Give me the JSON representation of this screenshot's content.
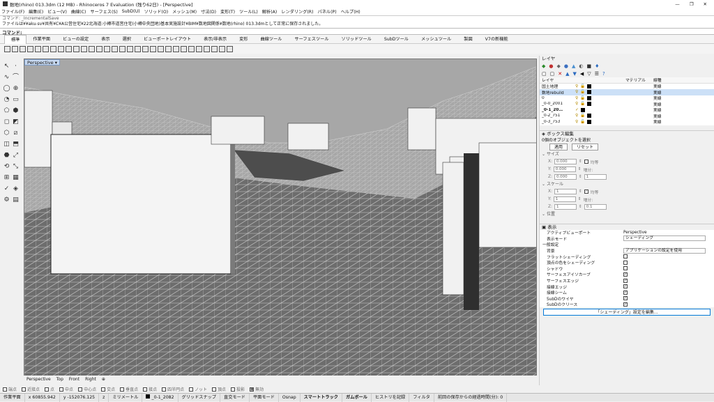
{
  "window": {
    "title": "数地(rhino) 013.3dm (12 MB) - Rhinoceros 7 Evaluation (残り62日) - [Perspective]"
  },
  "menu": [
    "ファイル(F)",
    "編集(E)",
    "ビュー(V)",
    "曲線(C)",
    "サーフェス(S)",
    "SubD(U)",
    "ソリッド(O)",
    "メッシュ(M)",
    "寸法(D)",
    "変形(T)",
    "ツール(L)",
    "解析(A)",
    "レンダリング(R)",
    "パネル(P)",
    "ヘルプ(H)"
  ],
  "cmd": {
    "line1": "コマンド: _IncrementalSave",
    "line2": "ファイルは¥¥aku-sv¥共有¥C¥A公営住宅¥22北海道:小樽市道営住宅(小樽中央団地)基本実施設計¥BIM¥数地図関係¥数地(rhino) 013.3dmとして正常に保存されました。",
    "prompt": "コマンド:"
  },
  "tabs": [
    "標準",
    "作業平面",
    "ビューの設定",
    "表示",
    "選択",
    "ビューポートレイアウト",
    "表示/非表示",
    "変形",
    "曲線ツール",
    "サーフェスツール",
    "ソリッドツール",
    "SubDツール",
    "メッシュツール",
    "製図",
    "V7の新機能"
  ],
  "viewport": {
    "name": "Perspective",
    "tabs": [
      "Perspective",
      "Top",
      "Front",
      "Right"
    ]
  },
  "layers": {
    "title": "レイヤ",
    "headers": {
      "name": "レイヤ",
      "material": "マテリアル",
      "linetype": "線種"
    },
    "rows": [
      {
        "name": "国土地理",
        "line": "実線",
        "sel": false
      },
      {
        "name": "数地rebuild",
        "line": "実線",
        "sel": true
      },
      {
        "name": "0",
        "line": "実線",
        "sel": false
      },
      {
        "name": "_0-0_2001",
        "line": "実線",
        "sel": false
      },
      {
        "name": "_0-1_20…",
        "line": "実線",
        "sel": false
      },
      {
        "name": "_0-2_751",
        "line": "実線",
        "sel": false
      },
      {
        "name": "_0-3_753",
        "line": "実線",
        "sel": false
      }
    ]
  },
  "box": {
    "title": "ボックス編集",
    "sub": "0個のオブジェクトを選択",
    "apply": "適用",
    "reset": "リセット",
    "size": "サイズ",
    "scale": "スケール",
    "position": "位置",
    "uniform": "均等",
    "inc": "増分:",
    "x": "0.000",
    "y": "0.000",
    "z": "0.000",
    "one": "1",
    "inc_val": "0.1"
  },
  "display": {
    "title": "表示",
    "rows": [
      {
        "label": "アクティブビューポート",
        "value": "Perspective"
      },
      {
        "label": "表示モード",
        "value": "シェーディング"
      },
      {
        "label": "一般設定",
        "value": ""
      },
      {
        "label": "背景",
        "value": "アプリケーションの設定を使用"
      },
      {
        "label": "フラットシェーディング",
        "value": "off"
      },
      {
        "label": "頂点の色をシェーディング",
        "value": "off"
      },
      {
        "label": "シャドウ",
        "value": "off"
      },
      {
        "label": "サーフェスアイソカーブ",
        "value": "on"
      },
      {
        "label": "サーフェスエッジ",
        "value": "on"
      },
      {
        "label": "接線エッジ",
        "value": "on"
      },
      {
        "label": "接線シーム",
        "value": "on"
      },
      {
        "label": "SubDのワイヤ",
        "value": "on"
      },
      {
        "label": "SubDのクリース",
        "value": "on"
      }
    ],
    "edit_btn": "「シェーディング」設定を編集..."
  },
  "osnap": [
    "端点",
    "近接点",
    "点",
    "中点",
    "中心点",
    "交点",
    "垂直点",
    "接点",
    "四半円点",
    "ノット",
    "頂点",
    "投影",
    "無効"
  ],
  "status": {
    "cplane": "作業平面",
    "x": "x 60855.942",
    "y": "y -152076.125",
    "z": "z",
    "unit": "ミリメートル",
    "layer": "_0-1_2082",
    "items": [
      "グリッドスナップ",
      "直交モード",
      "平面モード",
      "Osnap",
      "スマートトラック",
      "ガムボール",
      "ヒストリを記録",
      "フィルタ",
      "前回の保存からの経過時間(分): 0"
    ]
  },
  "colors": {
    "viewport_bg": "#a3a3a3",
    "selected_row": "#cce0f7",
    "accent": "#0078d7"
  }
}
